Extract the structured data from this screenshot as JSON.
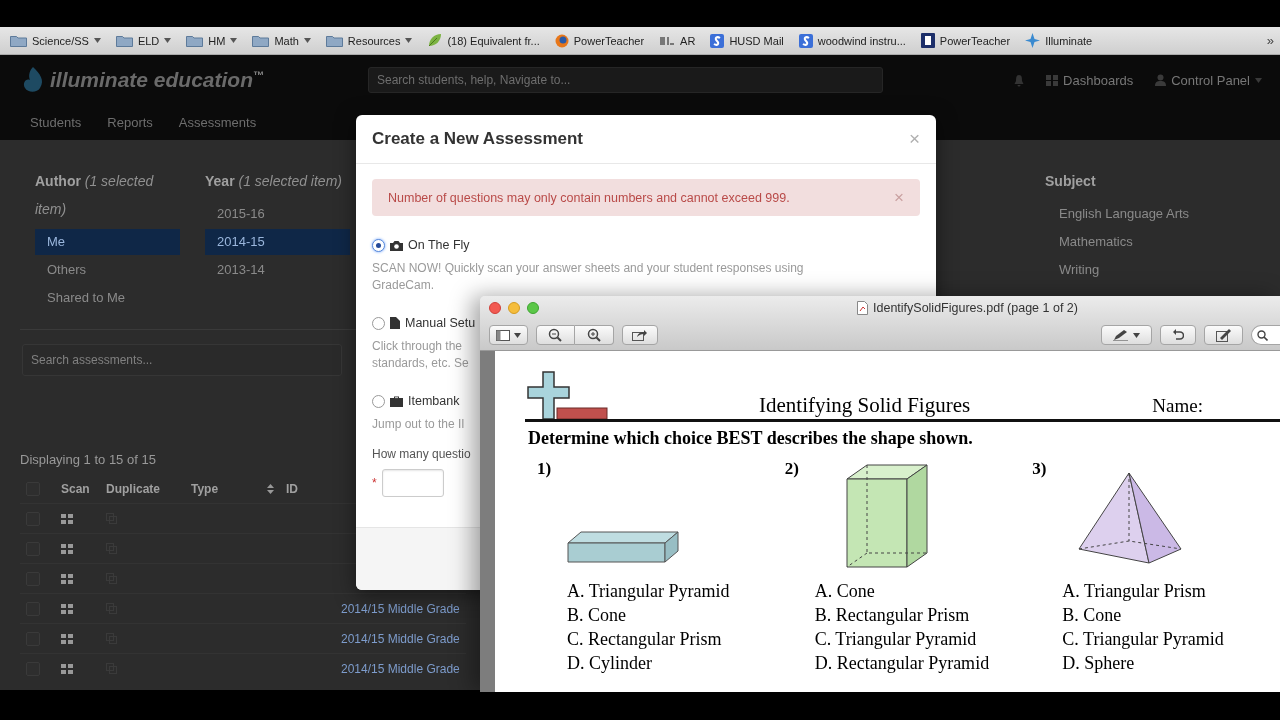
{
  "bookmarks": {
    "items": [
      {
        "kind": "folder",
        "label": "Science/SS"
      },
      {
        "kind": "folder",
        "label": "ELD"
      },
      {
        "kind": "folder",
        "label": "HM"
      },
      {
        "kind": "folder",
        "label": "Math"
      },
      {
        "kind": "folder",
        "label": "Resources"
      },
      {
        "kind": "leaf",
        "label": "(18) Equivalent fr..."
      },
      {
        "kind": "globe",
        "label": "PowerTeacher"
      },
      {
        "kind": "mark",
        "label": "AR"
      },
      {
        "kind": "square",
        "label": "HUSD Mail"
      },
      {
        "kind": "square",
        "label": "woodwind instru..."
      },
      {
        "kind": "navy",
        "label": "PowerTeacher"
      },
      {
        "kind": "star",
        "label": "Illuminate"
      }
    ],
    "overflow": "»"
  },
  "app": {
    "logo": "illuminate education$^{™}$",
    "search": {
      "placeholder": "Search students, help, Navigate to..."
    },
    "header_links": [
      {
        "kind": "bell"
      },
      {
        "kind": "grid",
        "label": "Dashboards"
      },
      {
        "kind": "user",
        "label": "Control Panel"
      }
    ],
    "nav": [
      "Students",
      "Reports",
      "Assessments"
    ],
    "filters": [
      {
        "title": "Author",
        "note": "(1 selected item)",
        "items": [
          {
            "label": "Me",
            "selected": true
          },
          {
            "label": "Others",
            "selected": false
          },
          {
            "label": "Shared to Me",
            "selected": false
          }
        ]
      },
      {
        "title": "Year",
        "note": "(1 selected item)",
        "items": [
          {
            "label": "2015-16",
            "selected": false
          },
          {
            "label": "2014-15",
            "selected": true
          },
          {
            "label": "2013-14",
            "selected": false
          }
        ]
      },
      {
        "title": "Subject",
        "items": [
          {
            "label": "English Language Arts",
            "selected": false
          },
          {
            "label": "Mathematics",
            "selected": false
          },
          {
            "label": "Writing",
            "selected": false
          }
        ]
      }
    ],
    "search_assessments": {
      "placeholder": "Search assessments..."
    },
    "displaying": "Displaying 1 to 15 of 15",
    "table": {
      "select_all": {
        "checked": false
      },
      "columns": [
        "Scan",
        "Duplicate",
        "Type",
        "ID"
      ],
      "rows": [
        {
          "checked": false
        },
        {
          "checked": false
        },
        {
          "checked": false
        },
        {
          "checked": false,
          "title": "2014/15 Middle Grade"
        },
        {
          "checked": false,
          "title": "2014/15 Middle Grade"
        },
        {
          "checked": false,
          "title": "2014/15 Middle Grade"
        }
      ]
    }
  },
  "modal": {
    "title": "Create a New Assessment",
    "close": "×",
    "alert": {
      "text": "Number of questions may only contain numbers and cannot exceed 999.",
      "close": "×"
    },
    "options": [
      {
        "kind": "camera",
        "label": "On The Fly",
        "selected": true,
        "description": [
          "SCAN NOW! Quickly scan your answer sheets and your student responses using GradeCam."
        ]
      },
      {
        "kind": "file",
        "label": "Manual Setu",
        "selected": false,
        "description": [
          "Click through the",
          "standards, etc. Se"
        ]
      },
      {
        "kind": "briefcase",
        "label": "Itembank",
        "selected": false,
        "description": [
          "Jump out to the Il"
        ]
      }
    ],
    "question_count": {
      "label": "How many questio",
      "required": "*"
    }
  },
  "pdf_viewer": {
    "title": "IdentifySolidFigures.pdf (page 1 of 2)",
    "page": {
      "title": "Identifying Solid Figures",
      "name_label": "Name:",
      "instruction": "Determine which choice BEST describes the shape shown.",
      "questions": [
        {
          "number": "1)",
          "kind": "slab",
          "choices": [
            "A. Triangular Pyramid",
            "B. Cone",
            "C. Rectangular Prism",
            "D. Cylinder"
          ]
        },
        {
          "number": "2)",
          "kind": "prism",
          "choices": [
            "A. Cone",
            "B. Rectangular Prism",
            "C. Triangular Pyramid",
            "D. Rectangular Pyramid"
          ]
        },
        {
          "number": "3)",
          "kind": "pyramid",
          "choices": [
            "A. Triangular Prism",
            "B. Cone",
            "C. Triangular Pyramid",
            "D. Sphere"
          ]
        }
      ]
    }
  }
}
